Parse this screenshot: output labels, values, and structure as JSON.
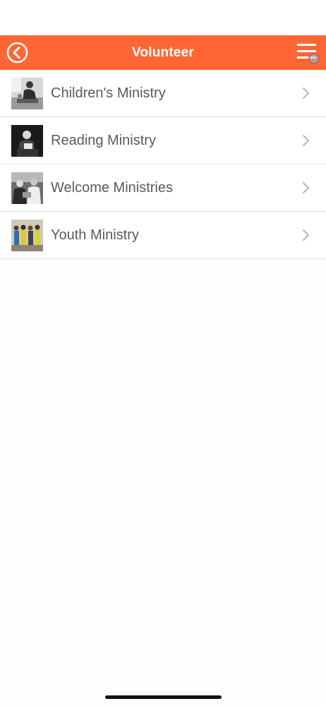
{
  "header": {
    "title": "Volunteer",
    "back_icon": "back-arrow-circle-icon",
    "menu_icon": "hamburger-menu-icon",
    "accent_color": "#ff6633"
  },
  "ministries": [
    {
      "label": "Children's Ministry",
      "thumbnail": "children-ministry-photo"
    },
    {
      "label": "Reading Ministry",
      "thumbnail": "reading-ministry-photo"
    },
    {
      "label": "Welcome Ministries",
      "thumbnail": "welcome-ministries-photo"
    },
    {
      "label": "Youth Ministry",
      "thumbnail": "youth-ministry-photo"
    }
  ]
}
